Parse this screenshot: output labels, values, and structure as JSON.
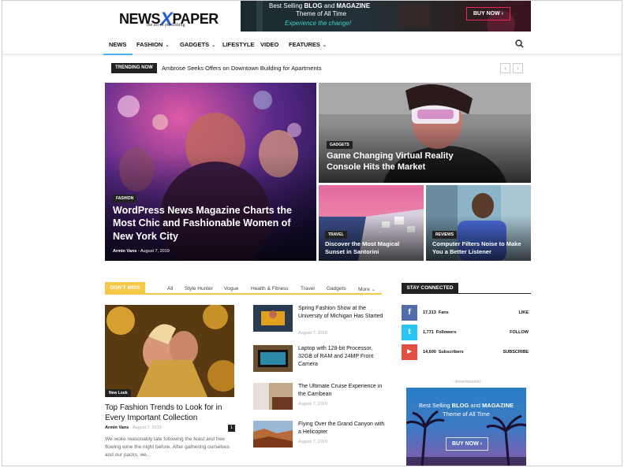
{
  "logo": {
    "main_left": "NEWS",
    "main_x": "X",
    "main_right": "PAPER",
    "tagline": "the art of publishing"
  },
  "top_ad": {
    "line1_pre": "Best Selling ",
    "line1_b1": "BLOG",
    "line1_mid": " and ",
    "line1_b2": "MAGAZINE",
    "line2": "Theme of All Time",
    "line3": "Experience the change!",
    "button": "BUY NOW",
    "arrow": "›"
  },
  "nav": {
    "items": [
      {
        "label": "NEWS",
        "caret": ""
      },
      {
        "label": "FASHION",
        "caret": "⌄"
      },
      {
        "label": "GADGETS",
        "caret": "⌄"
      },
      {
        "label": "LIFESTYLE",
        "caret": ""
      },
      {
        "label": "VIDEO",
        "caret": ""
      },
      {
        "label": "FEATURES",
        "caret": "⌄"
      }
    ]
  },
  "trending": {
    "tag": "TRENDING NOW",
    "headline": "Ambrose Seeks Offers on Downtown Building for Apartments",
    "prev": "‹",
    "next": "›"
  },
  "hero": {
    "main": {
      "category": "FASHION",
      "title": "WordPress News Magazine Charts the Most Chic and Fashionable Women of New York City",
      "author": "Armin Vans",
      "date": "August 7, 2019"
    },
    "top_right": {
      "category": "GADGETS",
      "title": "Game Changing Virtual Reality Console Hits the Market"
    },
    "bottom_left": {
      "category": "TRAVEL",
      "title": "Discover the Most Magical Sunset in Santorini"
    },
    "bottom_right": {
      "category": "REVIEWS",
      "title": "Computer Filters Noise to Make You a Better Listener"
    }
  },
  "dont_miss": {
    "tag": "DON'T MISS",
    "tabs": [
      "All",
      "Style Hunter",
      "Vogue",
      "Health & Fitness",
      "Travel",
      "Gadgets",
      "More"
    ],
    "more_caret": "⌄",
    "featured": {
      "category": "New Look",
      "title": "Top Fashion Trends to Look for in Every Important Collection",
      "author": "Armin Vans",
      "date": "August 7, 2019",
      "comments": "1",
      "excerpt": "We woke reasonably late following the feast and free flowing wine the night before. After gathering ourselves and our packs, we..."
    },
    "list": [
      {
        "title": "Spring Fashion Show at the University of Michigan Has Started",
        "date": "August 7, 2019"
      },
      {
        "title": "Laptop with 128-bit Processor, 32GB of RAM and 24MP Front Camera",
        "date": "August 7, 2019"
      },
      {
        "title": "The Ultimate Cruise Experience in the Carribean",
        "date": "August 7, 2019"
      },
      {
        "title": "Flying Over the Grand Canyon with a Helicopter",
        "date": "August 7, 2019"
      }
    ]
  },
  "stay_connected": {
    "tag": "STAY CONNECTED",
    "rows": [
      {
        "icon": "f",
        "count": "17,313",
        "unit": "Fans",
        "action": "LIKE",
        "color": "#516eab"
      },
      {
        "icon": "t",
        "count": "1,771",
        "unit": "Followers",
        "action": "FOLLOW",
        "color": "#29c5f6"
      },
      {
        "icon": "▶",
        "count": "14,600",
        "unit": "Subscribers",
        "action": "SUBSCRIBE",
        "color": "#e14e42"
      }
    ]
  },
  "side_ad": {
    "label": "- Advertisement -",
    "line1_pre": "Best Selling ",
    "line1_b1": "BLOG",
    "line1_mid": " and ",
    "line1_b2": "MAGAZINE",
    "line2": "Theme of All Time",
    "button": "BUY NOW",
    "arrow": "›"
  },
  "colors": {
    "accent": "#4db2ec",
    "dont_miss": "#f6c84a",
    "logo_x": "#2a5bd7",
    "teal": "#3fd1c8"
  }
}
